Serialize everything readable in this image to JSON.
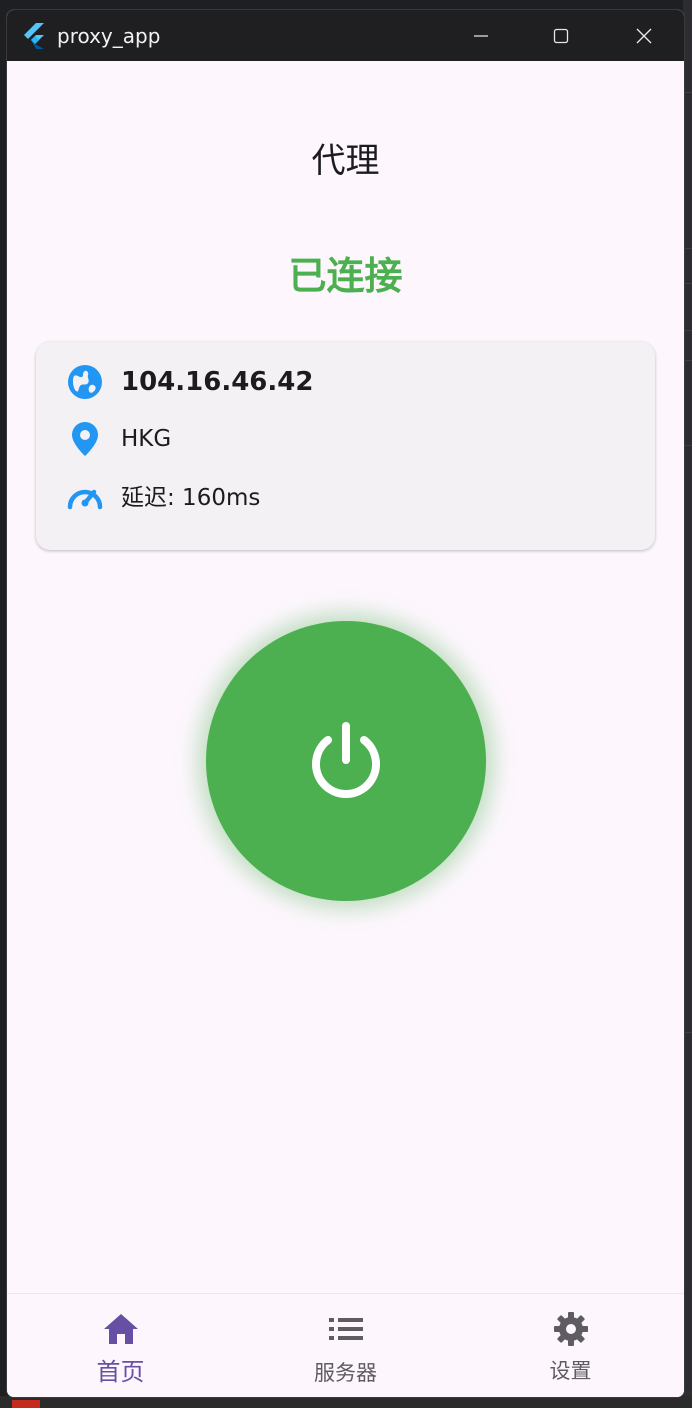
{
  "window": {
    "title": "proxy_app"
  },
  "page": {
    "title": "代理",
    "status": "已连接"
  },
  "info": {
    "ip": "104.16.46.42",
    "location": "HKG",
    "latency": "延迟: 160ms"
  },
  "nav": {
    "items": [
      {
        "label": "首页",
        "icon": "home-icon",
        "selected": true
      },
      {
        "label": "服务器",
        "icon": "list-icon",
        "selected": false
      },
      {
        "label": "设置",
        "icon": "gear-icon",
        "selected": false
      }
    ]
  },
  "colors": {
    "accent": "#6750a4",
    "connected": "#4caf50",
    "info_icon": "#2196f3",
    "background": "#fdf7fd"
  }
}
